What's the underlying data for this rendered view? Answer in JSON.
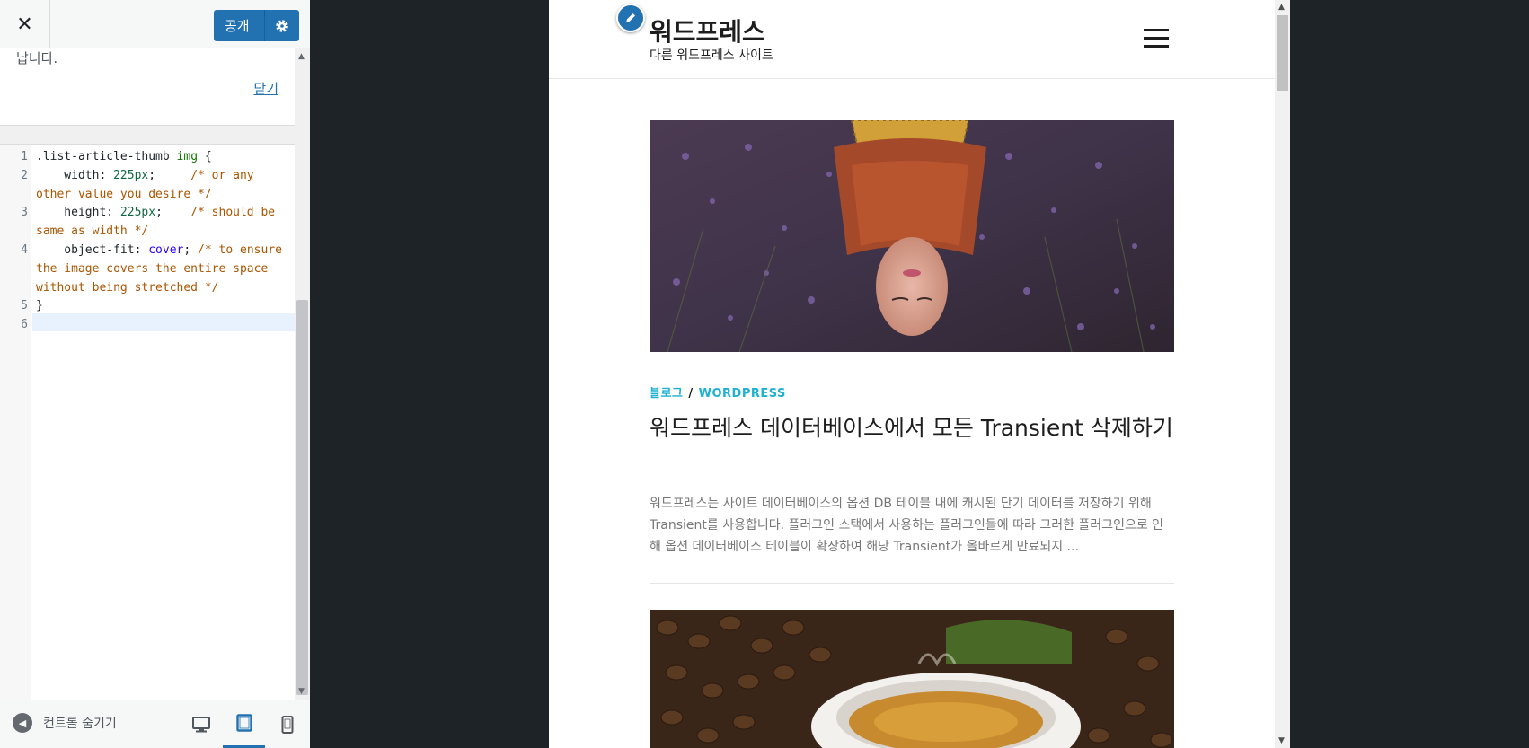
{
  "panel": {
    "close_glyph": "✕",
    "publish_label": "공개",
    "notice_text": "납니다.",
    "notice_close": "닫기"
  },
  "editor": {
    "line_numbers": [
      "1",
      "2",
      "3",
      "4",
      "5",
      "6"
    ],
    "code": {
      "l1_selector": ".list-article-thumb ",
      "l1_tag": "img",
      "l1_brace": " {",
      "l2_prop": "    width: ",
      "l2_val": "225px",
      "l2_semi": ";",
      "l2_cmt_a": "     /* or any",
      "l2_cmt_b": "other value you desire */",
      "l3_prop": "    height: ",
      "l3_val": "225px",
      "l3_semi": ";",
      "l3_cmt_a": "    /* should be",
      "l3_cmt_b": "same as width */",
      "l4_prop": "    object-fit: ",
      "l4_val": "cover",
      "l4_semi": ";",
      "l4_cmt_a": " /* to ensure",
      "l4_cmt_b": "the image covers the entire space",
      "l4_cmt_c": "without being stretched */",
      "l5_brace": "}"
    }
  },
  "footer": {
    "collapse_label": "컨트롤 숨기기",
    "devices": [
      "desktop-icon",
      "tablet-icon",
      "mobile-icon"
    ],
    "active_device": "tablet"
  },
  "site": {
    "title": "워드프레스",
    "tagline": "다른 워드프레스 사이트"
  },
  "post": {
    "categories": [
      "블로그",
      "WORDPRESS"
    ],
    "category_separator": "/",
    "title": "워드프레스 데이터베이스에서 모든 Transient 삭제하기",
    "excerpt": "워드프레스는 사이트 데이터베이스의 옵션 DB 테이블 내에 캐시된 단기 데이터를 저장하기 위해 Transient를 사용합니다. 플러그인 스택에서 사용하는 플러그인들에 따라 그러한 플러그인으로 인해 옵션 데이터베이스 테이블이 확장하여 해당 Transient가 올바르게 만료되지 ..."
  },
  "colors": {
    "accent": "#2271b1",
    "category": "#1fb1d1",
    "backdrop": "#1d2327"
  }
}
